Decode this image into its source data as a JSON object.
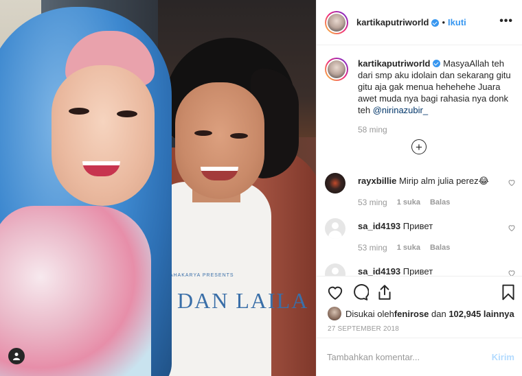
{
  "post": {
    "username": "kartikaputriworld",
    "separator": "•",
    "follow_label": "Ikuti",
    "more_icon": "more-options-icon"
  },
  "photo": {
    "shirt_text": "1 DAN LAILA",
    "shirt_small_text": "MAHAKARYA PRESENTS",
    "user_tag_icon": "user-tag-icon"
  },
  "caption": {
    "username": "kartikaputriworld",
    "text": "MasyaAllah teh dari smp aku idolain dan sekarang gitu gitu aja gak menua hehehehe Juara awet muda nya bagi rahasia nya donk teh ",
    "mention": "@nirinazubir_",
    "time": "58 ming",
    "load_more_icon": "plus-circle-icon"
  },
  "comments": [
    {
      "username": "rayxbillie",
      "text": "Mirip alm julia perez😂",
      "time": "53 ming",
      "likes": "1 suka",
      "reply": "Balas"
    },
    {
      "username": "sa_id4193",
      "text": "Привет",
      "time": "53 ming",
      "likes": "1 suka",
      "reply": "Balas"
    },
    {
      "username": "sa_id4193",
      "text": "Привет"
    }
  ],
  "actions": {
    "liked_by_prefix": "Disukai oleh ",
    "liked_by_user": "fenirose",
    "liked_by_middle": " dan ",
    "liked_by_count": "102,945 lainnya",
    "date": "27 SEPTEMBER 2018"
  },
  "comment_input": {
    "placeholder": "Tambahkan komentar...",
    "post_label": "Kirim"
  },
  "colors": {
    "accent": "#3897f0",
    "post_disabled": "#b3dbff",
    "muted": "#999999"
  }
}
